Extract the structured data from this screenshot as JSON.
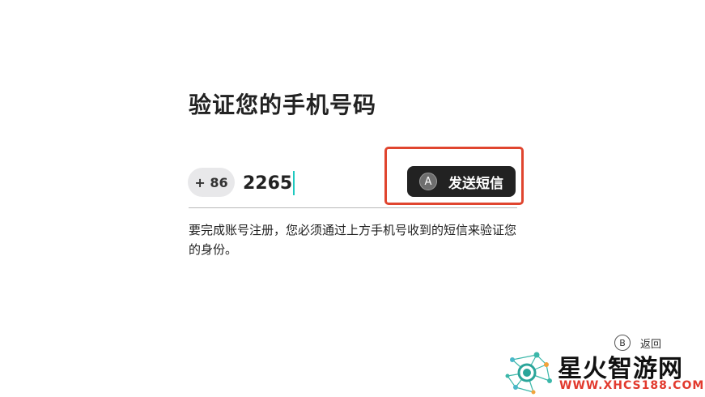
{
  "page": {
    "title": "验证您的手机号码",
    "description": "要完成账号注册，您必须通过上方手机号收到的短信来验证您的身份。"
  },
  "phone": {
    "country_code": "+ 86",
    "value": "2265"
  },
  "send_button": {
    "key_hint": "A",
    "label": "发送短信"
  },
  "footer": {
    "back_key_hint": "B",
    "back_label": "返回"
  },
  "watermark": {
    "name": "星火智游网",
    "url": "WWW.XHCS188.COM"
  },
  "colors": {
    "highlight": "#e0452f",
    "caret": "#1fc9c0",
    "button_bg": "#222222",
    "watermark_url": "#e23a2e"
  }
}
